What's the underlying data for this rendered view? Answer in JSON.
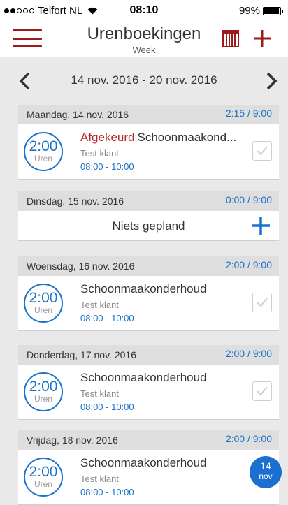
{
  "status_bar": {
    "carrier": "Telfort NL",
    "time": "08:10",
    "battery": "99%"
  },
  "header": {
    "title": "Urenboekingen",
    "subtitle": "Week",
    "accent_color": "#9b1b1b"
  },
  "week_nav": {
    "range": "14 nov. 2016 - 20 nov. 2016"
  },
  "days": [
    {
      "name": "Maandag, 14 nov. 2016",
      "total": "2:15 / 9:00",
      "entry": {
        "hours": "2:00",
        "unit": "Uren",
        "status": "Afgekeurd",
        "title": "Schoonmaakond...",
        "client": "Test klant",
        "time": "08:00 - 10:00"
      }
    },
    {
      "name": "Dinsdag, 15 nov. 2016",
      "total": "0:00 / 9:00",
      "empty_text": "Niets gepland"
    },
    {
      "name": "Woensdag, 16 nov. 2016",
      "total": "2:00 / 9:00",
      "entry": {
        "hours": "2:00",
        "unit": "Uren",
        "title": "Schoonmaakonderhoud",
        "client": "Test klant",
        "time": "08:00 - 10:00"
      }
    },
    {
      "name": "Donderdag, 17 nov. 2016",
      "total": "2:00 / 9:00",
      "entry": {
        "hours": "2:00",
        "unit": "Uren",
        "title": "Schoonmaakonderhoud",
        "client": "Test klant",
        "time": "08:00 - 10:00"
      }
    },
    {
      "name": "Vrijdag, 18 nov. 2016",
      "total": "2:00 / 9:00",
      "entry": {
        "hours": "2:00",
        "unit": "Uren",
        "title": "Schoonmaakonderhoud",
        "client": "Test klant",
        "time": "08:00 - 10:00"
      }
    }
  ],
  "date_badge": {
    "day": "14",
    "month": "nov"
  }
}
